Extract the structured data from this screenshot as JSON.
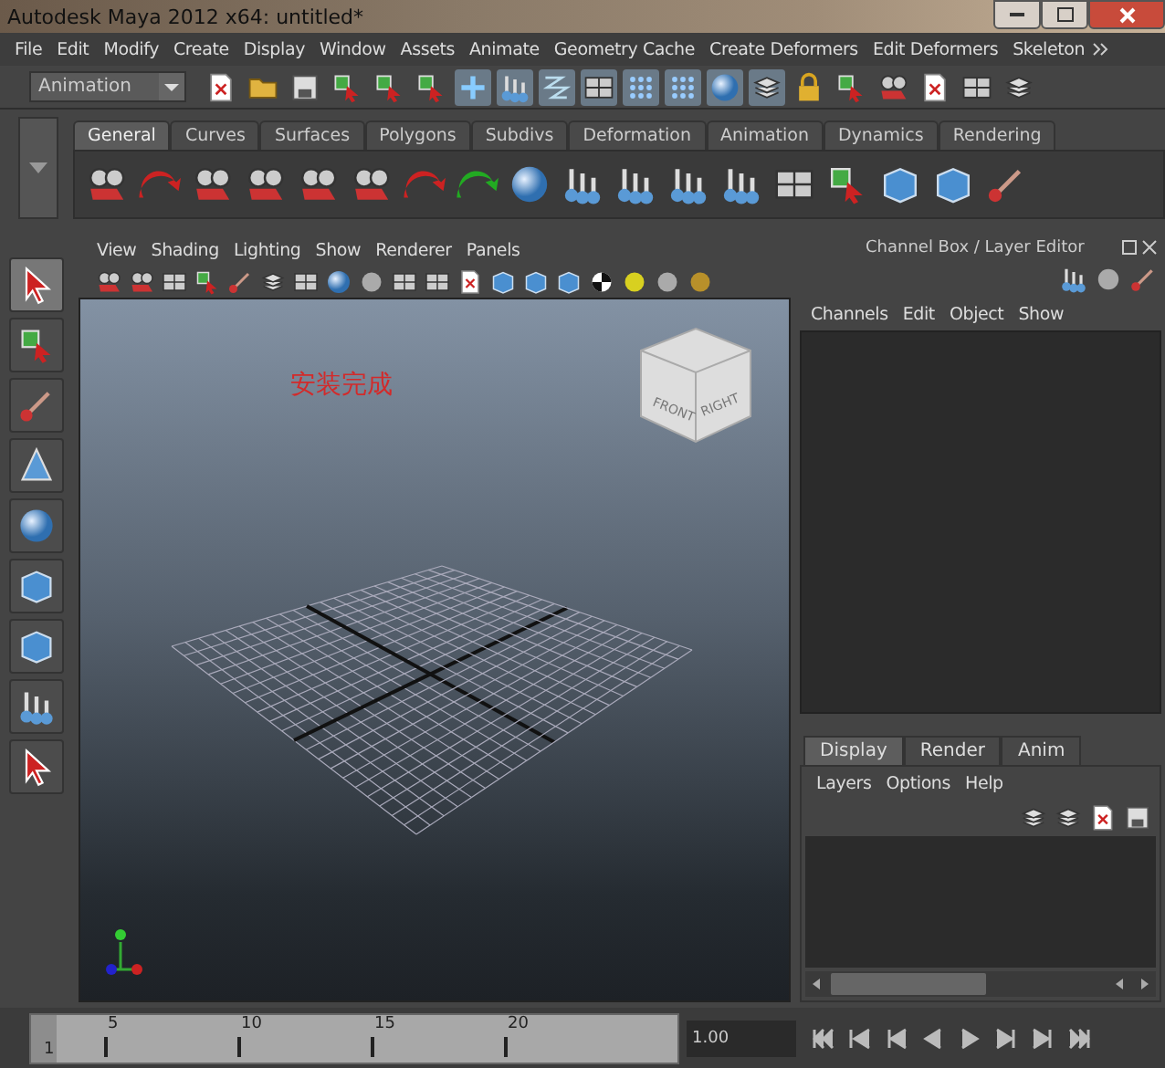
{
  "window": {
    "title": "Autodesk Maya 2012 x64: untitled*"
  },
  "menu_bar": [
    "File",
    "Edit",
    "Modify",
    "Create",
    "Display",
    "Window",
    "Assets",
    "Animate",
    "Geometry Cache",
    "Create Deformers",
    "Edit Deformers",
    "Skeleton"
  ],
  "status_line": {
    "menu_set": "Animation"
  },
  "shelf": {
    "tabs": [
      {
        "label": "General",
        "selected": true
      },
      {
        "label": "Curves",
        "selected": false
      },
      {
        "label": "Surfaces",
        "selected": false
      },
      {
        "label": "Polygons",
        "selected": false
      },
      {
        "label": "Subdivs",
        "selected": false
      },
      {
        "label": "Deformation",
        "selected": false
      },
      {
        "label": "Animation",
        "selected": false
      },
      {
        "label": "Dynamics",
        "selected": false
      },
      {
        "label": "Rendering",
        "selected": false
      }
    ]
  },
  "viewport_panel": {
    "menu": [
      "View",
      "Shading",
      "Lighting",
      "Show",
      "Renderer",
      "Panels"
    ],
    "overlay_text": "安装完成",
    "view_cube": {
      "front": "FRONT",
      "right": "RIGHT"
    }
  },
  "channel_box": {
    "title": "Channel Box / Layer Editor",
    "menu": [
      "Channels",
      "Edit",
      "Object",
      "Show"
    ]
  },
  "layer_editor": {
    "tabs": [
      {
        "label": "Display",
        "selected": true
      },
      {
        "label": "Render",
        "selected": false
      },
      {
        "label": "Anim",
        "selected": false
      }
    ],
    "menu": [
      "Layers",
      "Options",
      "Help"
    ]
  },
  "time_slider": {
    "ticks": [
      "1",
      "5",
      "10",
      "15",
      "20"
    ],
    "current_time": "1.00",
    "level": 0
  }
}
